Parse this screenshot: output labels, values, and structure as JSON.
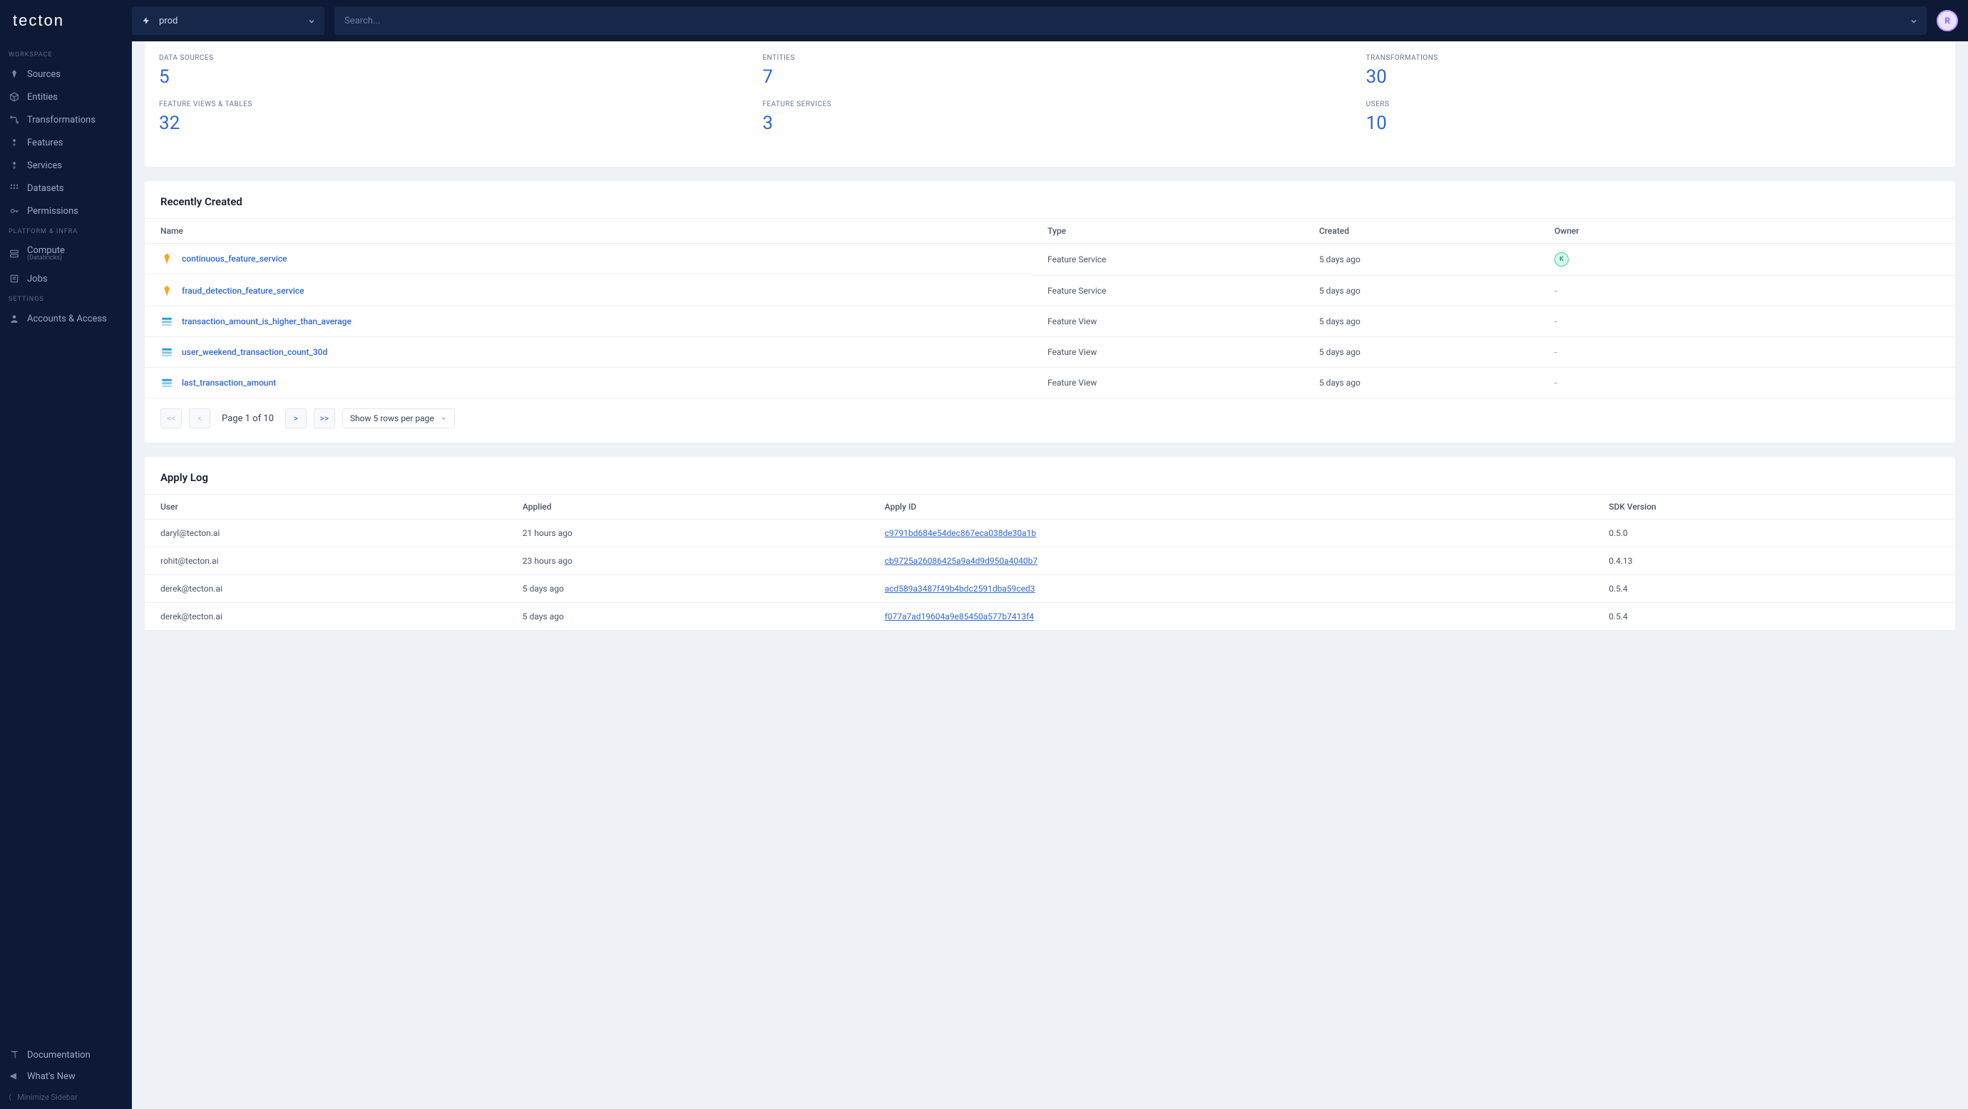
{
  "brand": "tecton",
  "topbar": {
    "env": "prod",
    "search_placeholder": "Search...",
    "avatar_initial": "R"
  },
  "sidebar": {
    "sections": {
      "workspace": {
        "label": "WORKSPACE",
        "items": [
          {
            "label": "Sources",
            "icon": "diamond"
          },
          {
            "label": "Entities",
            "icon": "cube"
          },
          {
            "label": "Transformations",
            "icon": "flow"
          },
          {
            "label": "Features",
            "icon": "diamond3"
          },
          {
            "label": "Services",
            "icon": "diamond3b"
          },
          {
            "label": "Datasets",
            "icon": "dots"
          },
          {
            "label": "Permissions",
            "icon": "key"
          }
        ]
      },
      "platform": {
        "label": "PLATFORM & INFRA",
        "items": [
          {
            "label": "Compute",
            "sub": "(Databricks)",
            "icon": "server"
          },
          {
            "label": "Jobs",
            "icon": "list"
          }
        ]
      },
      "settings": {
        "label": "SETTINGS",
        "items": [
          {
            "label": "Accounts & Access",
            "icon": "user"
          }
        ]
      }
    },
    "bottom": [
      {
        "label": "Documentation",
        "icon": "book"
      },
      {
        "label": "What's New",
        "icon": "megaphone"
      }
    ],
    "minimize_label": "Minimize Sidebar"
  },
  "stats": [
    {
      "label": "DATA SOURCES",
      "value": "5"
    },
    {
      "label": "ENTITIES",
      "value": "7"
    },
    {
      "label": "TRANSFORMATIONS",
      "value": "30"
    },
    {
      "label": "FEATURE VIEWS & TABLES",
      "value": "32"
    },
    {
      "label": "FEATURE SERVICES",
      "value": "3"
    },
    {
      "label": "USERS",
      "value": "10"
    }
  ],
  "recently_created": {
    "title": "Recently Created",
    "columns": [
      "Name",
      "Type",
      "Created",
      "Owner"
    ],
    "rows": [
      {
        "name": "continuous_feature_service",
        "icon": "service",
        "type": "Feature Service",
        "created": "5 days ago",
        "owner": "K"
      },
      {
        "name": "fraud_detection_feature_service",
        "icon": "service",
        "type": "Feature Service",
        "created": "5 days ago",
        "owner": "-"
      },
      {
        "name": "transaction_amount_is_higher_than_average",
        "icon": "view",
        "type": "Feature View",
        "created": "5 days ago",
        "owner": "-"
      },
      {
        "name": "user_weekend_transaction_count_30d",
        "icon": "view",
        "type": "Feature View",
        "created": "5 days ago",
        "owner": "-"
      },
      {
        "name": "last_transaction_amount",
        "icon": "view",
        "type": "Feature View",
        "created": "5 days ago",
        "owner": "-"
      }
    ],
    "pagination": {
      "first": "<<",
      "prev": "<",
      "next": ">",
      "last": ">>",
      "page_label": "Page 1 of 10",
      "rows_per_page": "Show 5 rows per page"
    }
  },
  "apply_log": {
    "title": "Apply Log",
    "columns": [
      "User",
      "Applied",
      "Apply ID",
      "SDK Version"
    ],
    "rows": [
      {
        "user": "daryl@tecton.ai",
        "applied": "21 hours ago",
        "id": "c9791bd684e54dec867eca038de30a1b",
        "sdk": "0.5.0"
      },
      {
        "user": "rohit@tecton.ai",
        "applied": "23 hours ago",
        "id": "cb9725a26086425a9a4d9d950a4040b7",
        "sdk": "0.4.13"
      },
      {
        "user": "derek@tecton.ai",
        "applied": "5 days ago",
        "id": "acd589a3487f49b4bdc2591dba59ced3",
        "sdk": "0.5.4"
      },
      {
        "user": "derek@tecton.ai",
        "applied": "5 days ago",
        "id": "f077a7ad19604a9e85450a577b7413f4",
        "sdk": "0.5.4"
      }
    ]
  }
}
